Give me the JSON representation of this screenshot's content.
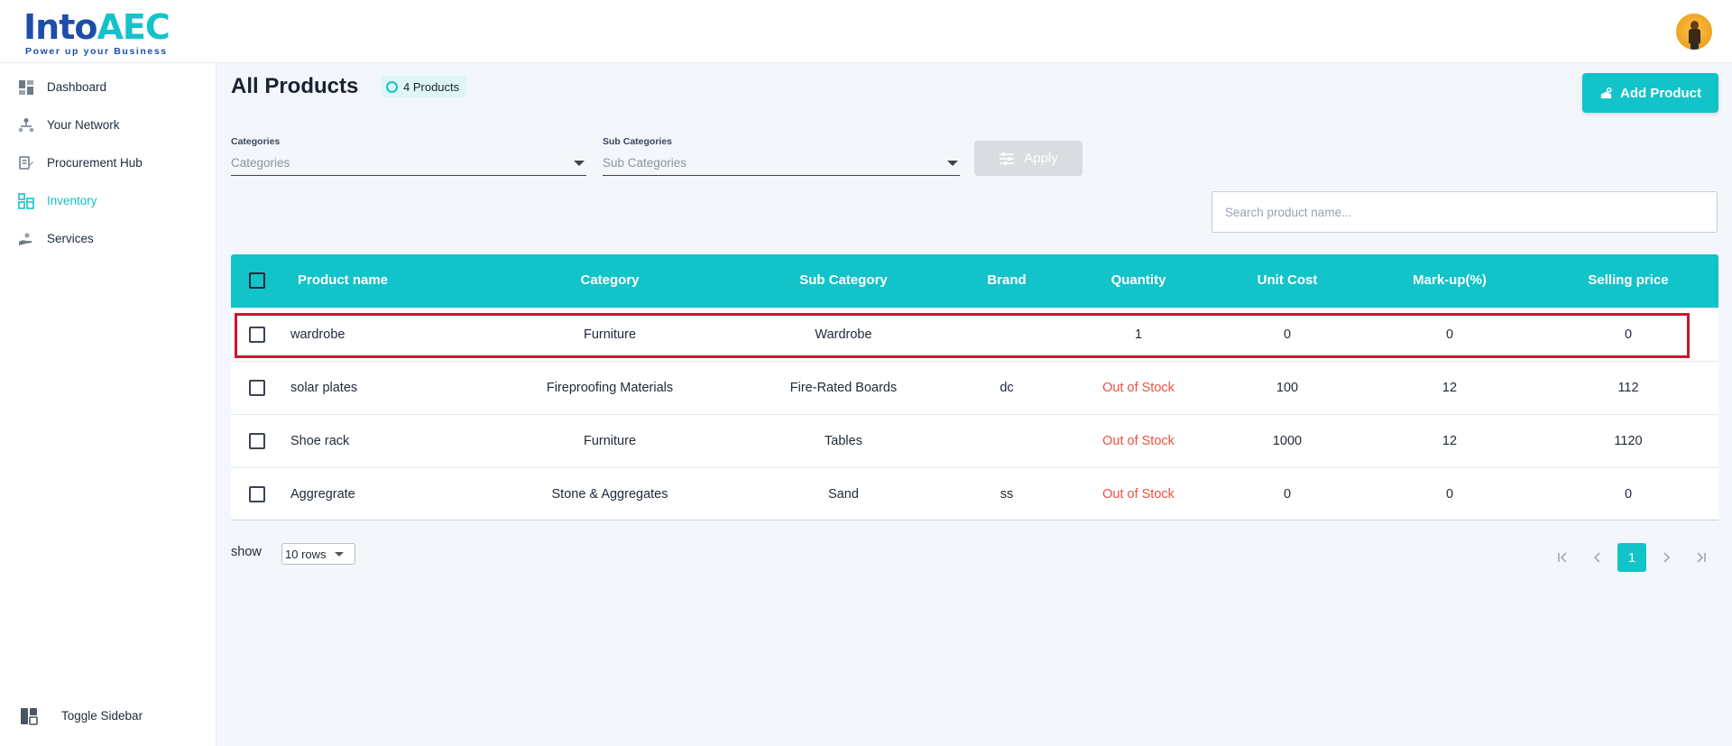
{
  "header": {
    "logo": {
      "text_main": "Into",
      "text_accent": "AEC",
      "tagline": "Power up your Business"
    },
    "avatar_icon": "user-avatar"
  },
  "sidebar": {
    "items": [
      {
        "label": "Dashboard",
        "icon": "dashboard-icon"
      },
      {
        "label": "Your Network",
        "icon": "network-icon"
      },
      {
        "label": "Procurement Hub",
        "icon": "procurement-icon"
      },
      {
        "label": "Inventory",
        "icon": "inventory-icon",
        "active": true
      },
      {
        "label": "Services",
        "icon": "services-icon"
      }
    ],
    "toggle_label": "Toggle Sidebar"
  },
  "page": {
    "title": "All Products",
    "count_badge": "4 Products",
    "add_button": "Add Product"
  },
  "filters": {
    "categories_label": "Categories",
    "categories_placeholder": "Categories",
    "subcategories_label": "Sub Categories",
    "subcategories_placeholder": "Sub Categories",
    "apply_button": "Apply",
    "search_placeholder": "Search product name..."
  },
  "table": {
    "columns": [
      "Product name",
      "Category",
      "Sub Category",
      "Brand",
      "Quantity",
      "Unit Cost",
      "Mark-up(%)",
      "Selling price"
    ],
    "rows": [
      {
        "name": "wardrobe",
        "category": "Furniture",
        "sub_category": "Wardrobe",
        "brand": "",
        "quantity": "1",
        "unit_cost": "0",
        "markup": "0",
        "selling_price": "0",
        "highlighted": true
      },
      {
        "name": "solar plates",
        "category": "Fireproofing Materials",
        "sub_category": "Fire-Rated Boards",
        "brand": "dc",
        "quantity": "Out of Stock",
        "unit_cost": "100",
        "markup": "12",
        "selling_price": "112"
      },
      {
        "name": "Shoe rack",
        "category": "Furniture",
        "sub_category": "Tables",
        "brand": "",
        "quantity": "Out of Stock",
        "unit_cost": "1000",
        "markup": "12",
        "selling_price": "1120"
      },
      {
        "name": "Aggregrate",
        "category": "Stone & Aggregates",
        "sub_category": "Sand",
        "brand": "ss",
        "quantity": "Out of Stock",
        "unit_cost": "0",
        "markup": "0",
        "selling_price": "0"
      }
    ]
  },
  "footer": {
    "show_label": "show",
    "rows_per_page": "10 rows",
    "current_page": "1"
  },
  "colors": {
    "accent": "#12c3c9",
    "out_of_stock": "#f0503f",
    "highlight_border": "#d0142c"
  }
}
